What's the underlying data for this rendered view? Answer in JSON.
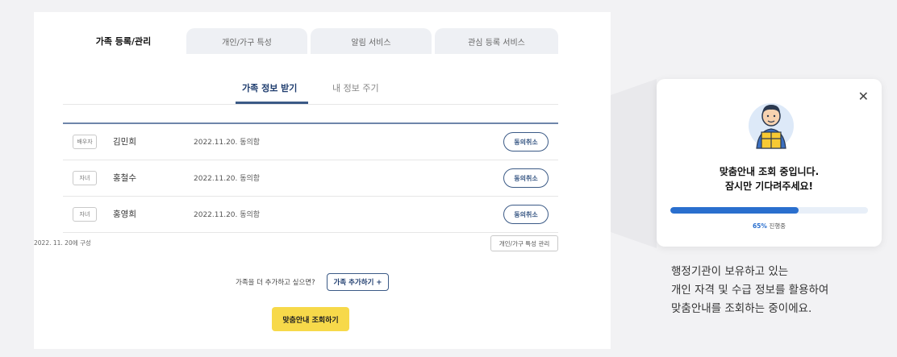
{
  "tabs": [
    {
      "label": "가족 등록/관리",
      "active": true
    },
    {
      "label": "개인/가구 특성",
      "active": false
    },
    {
      "label": "알림 서비스",
      "active": false
    },
    {
      "label": "관심 등록 서비스",
      "active": false
    }
  ],
  "subtabs": [
    {
      "label": "가족 정보 받기",
      "active": true
    },
    {
      "label": "내 정보 주기",
      "active": false
    }
  ],
  "family_rows": [
    {
      "relation": "배우자",
      "name": "김민희",
      "date": "2022.11.20. 동의함",
      "action": "동의취소"
    },
    {
      "relation": "자녀",
      "name": "홍철수",
      "date": "2022.11.20. 동의함",
      "action": "동의취소"
    },
    {
      "relation": "자녀",
      "name": "홍영희",
      "date": "2022.11.20. 동의함",
      "action": "동의취소"
    }
  ],
  "composed_date": "2022. 11. 20에 구성",
  "manage_button": "개인/가구 특성 관리",
  "add_question": "가족을 더 추가하고 싶으면?",
  "add_button": "가족 추가하기 +",
  "cta_button": "맞춤안내 조회하기",
  "popup": {
    "line1": "맞춤안내 조회 중입니다.",
    "line2": "잠시만 기다려주세요!",
    "progress": 0.65,
    "progress_pct": "65%",
    "progress_text": "진행중",
    "close_icon": "close-icon",
    "accent": "#2a6fce"
  },
  "description": {
    "line1": "행정기관이 보유하고 있는",
    "line2": "개인 자격 및 수급 정보를 활용하여",
    "line3": "맞춤안내를 조회하는 중이에요."
  }
}
